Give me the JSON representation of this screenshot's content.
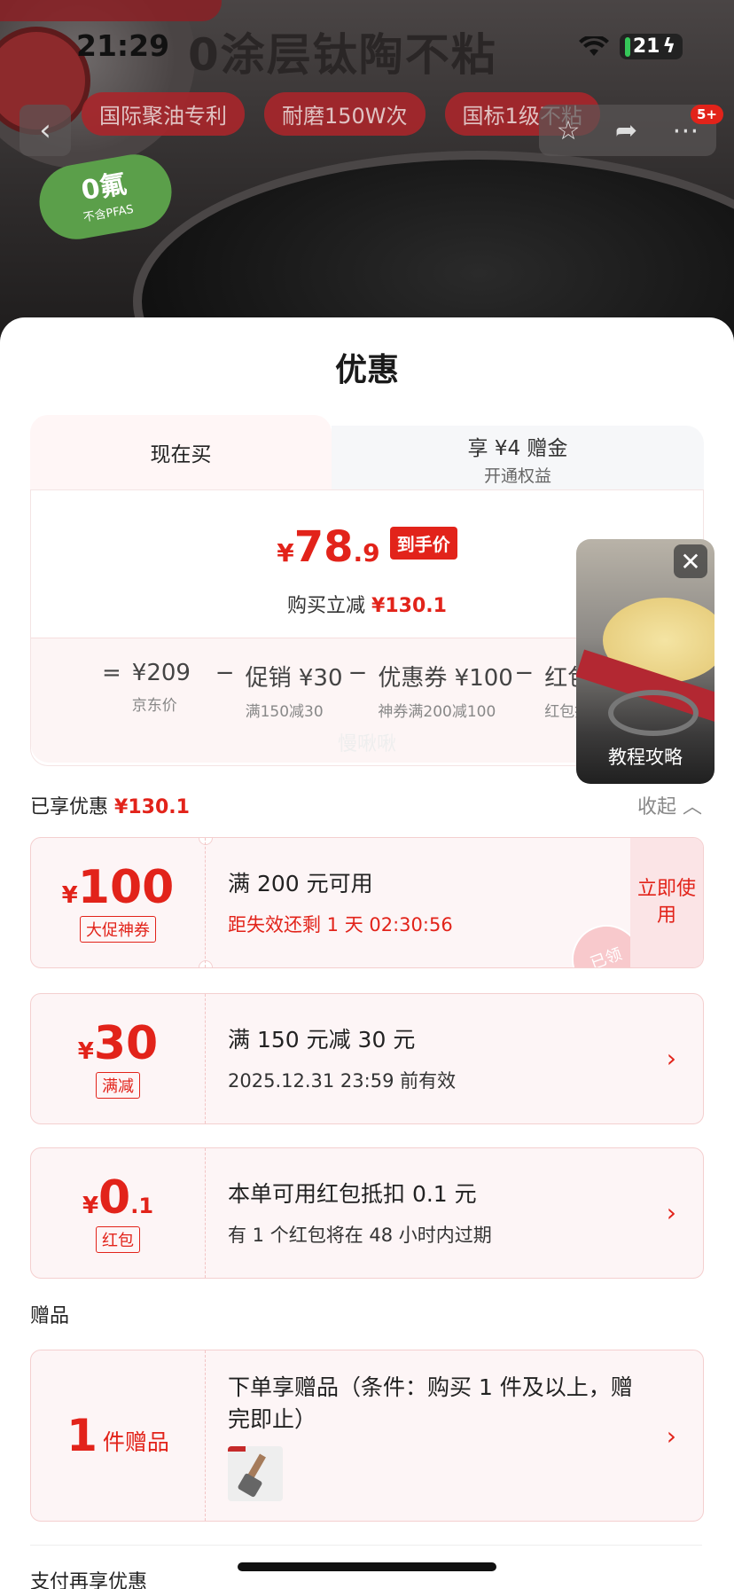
{
  "status_bar": {
    "time": "21:29",
    "battery": "21"
  },
  "product_bg": {
    "headline": "0涂层钛陶不粘",
    "tags": [
      "国际聚油专利",
      "耐磨150W次",
      "国标1级不粘"
    ],
    "cart_count": "5+",
    "badge_big": "0氟",
    "badge_small": "不含PFAS"
  },
  "sheet": {
    "title": "优惠",
    "video": {
      "label": "教程攻略"
    },
    "tabs": {
      "now": "现在买",
      "vip_line1": "享 ¥4 赠金",
      "vip_line2": "开通权益"
    },
    "price": {
      "yen": "¥",
      "integer": "78",
      "decimal": ".9",
      "badge": "到手价",
      "sub_label": "购买立减",
      "sub_value": "¥130.1"
    },
    "breakdown": {
      "eq": "=",
      "op": "−",
      "items": [
        {
          "value": "¥209",
          "label": "京东价"
        },
        {
          "value": "促销 ¥30",
          "label": "满150减30"
        },
        {
          "value": "优惠券 ¥100",
          "label": "神券满200减100"
        },
        {
          "value": "红包 ¥0.1",
          "label": "红包抵0.1"
        }
      ]
    },
    "watermark": "慢啾啾",
    "enjoyed": {
      "label": "已享优惠",
      "value": "¥130.1",
      "collapse": "收起"
    },
    "coupons": [
      {
        "yen": "¥",
        "amount": "100",
        "decimal": "",
        "tag": "大促神券",
        "title": "满 200 元可用",
        "sub": "距失效还剩 1 天 02:30:56",
        "action": "立即使用",
        "stamp": "已领"
      },
      {
        "yen": "¥",
        "amount": "30",
        "decimal": "",
        "tag": "满减",
        "title": "满 150 元减 30 元",
        "sub": "2025.12.31 23:59 前有效"
      },
      {
        "yen": "¥",
        "amount": "0",
        "decimal": ".1",
        "tag": "红包",
        "title": "本单可用红包抵扣 0.1 元",
        "sub": "有 1 个红包将在 48 小时内过期"
      }
    ],
    "gift_section": "赠品",
    "gift": {
      "count": "1",
      "unit": "件赠品",
      "desc": "下单享赠品（条件：购买 1 件及以上，赠完即止）"
    },
    "pay_more": "支付再享优惠"
  },
  "colors": {
    "accent": "#e2231a",
    "card_bg": "#fdf5f6",
    "tag_bg": "#a9262b"
  }
}
